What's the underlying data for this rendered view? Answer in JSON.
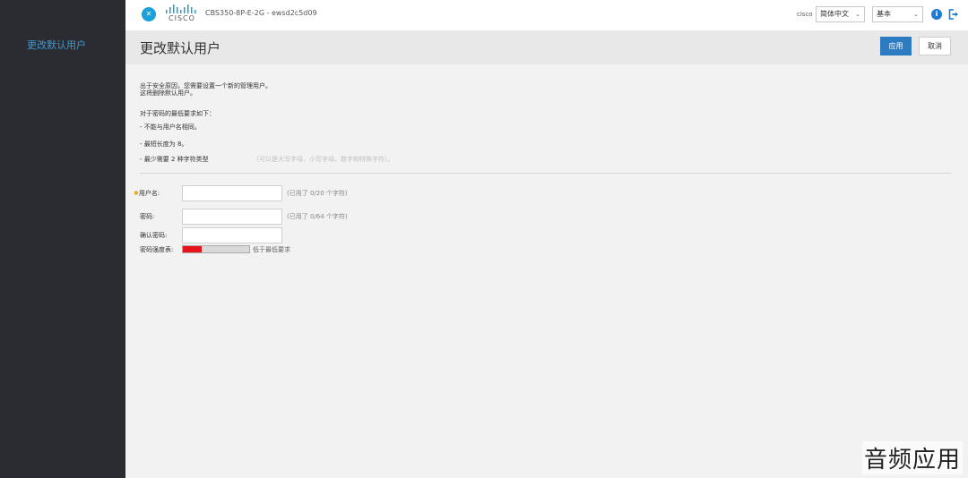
{
  "sidebar": {
    "items": [
      {
        "label": "更改默认用户"
      }
    ]
  },
  "header": {
    "logo_text": "CISCO",
    "device_name": "CBS350-8P-E-2G - ewsd2c5d09",
    "user": "cisco",
    "language": "简体中文",
    "mode": "基本",
    "icons": [
      "info-icon",
      "logout-icon"
    ],
    "accent_color": "#1ba0d7"
  },
  "page": {
    "title": "更改默认用户",
    "apply_label": "应用",
    "cancel_label": "取消"
  },
  "intro": {
    "line1": "出于安全原因，您需要设置一个新的管理用户。",
    "line2": "这将删除默认用户。"
  },
  "rules": {
    "heading": "对于密码的最低要求如下：",
    "items": [
      "- 不能与用户名相同。",
      "- 最短长度为 8。",
      "- 最少需要 2 种字符类型"
    ],
    "types_note": "（可以是大写字母、小写字母、数字和特殊字符）。"
  },
  "form": {
    "username_label": "用户名:",
    "username_hint": "(已用了 0/20 个字符)",
    "password_label": "密码:",
    "password_hint": "(已用了 0/64 个字符)",
    "confirm_label": "确认密码:",
    "strength_label": "密码强度表:",
    "strength_text": "低于最低要求",
    "strength_value": 0.28,
    "strength_color": "#e8141c"
  },
  "watermark": "音频应用"
}
